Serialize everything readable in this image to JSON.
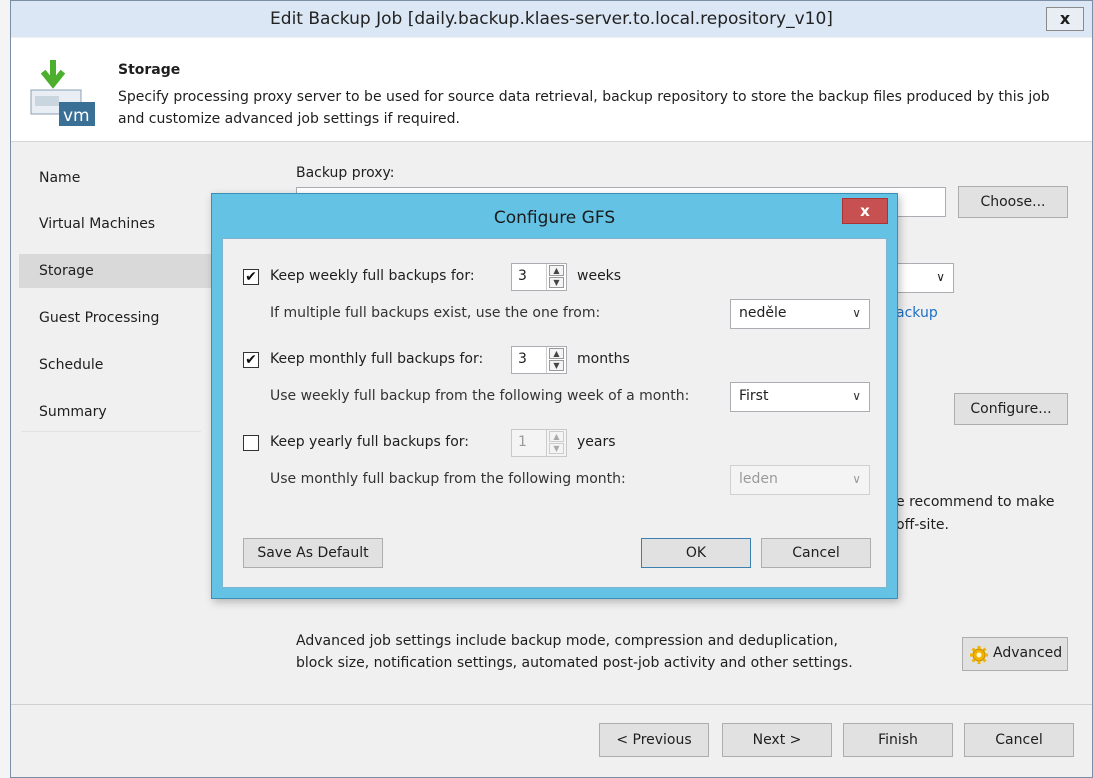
{
  "window": {
    "title": "Edit Backup Job [daily.backup.klaes-server.to.local.repository_v10]",
    "close_glyph": "x"
  },
  "header": {
    "icon_text": "vm",
    "title": "Storage",
    "description": "Specify processing proxy server to be used for source data retrieval, backup repository to store the backup files produced by this job and customize advanced job settings if required."
  },
  "nav": {
    "items": [
      {
        "label": "Name"
      },
      {
        "label": "Virtual Machines"
      },
      {
        "label": "Storage"
      },
      {
        "label": "Guest Processing"
      },
      {
        "label": "Schedule"
      },
      {
        "label": "Summary"
      }
    ],
    "active_index": 2
  },
  "content": {
    "backup_proxy_label": "Backup proxy:",
    "choose_button": "Choose...",
    "backup_link_fragment": "ackup",
    "configure_button": "Configure...",
    "recommend_line1": "e recommend to make",
    "recommend_line2": "off-site.",
    "advanced_text_line1": "Advanced job settings include backup mode, compression and deduplication,",
    "advanced_text_line2": "block size, notification settings, automated post-job activity and other settings.",
    "advanced_button": "Advanced"
  },
  "footer": {
    "previous": "< Previous",
    "next": "Next >",
    "finish": "Finish",
    "cancel": "Cancel"
  },
  "dialog": {
    "title": "Configure GFS",
    "close_glyph": "x",
    "weekly": {
      "checked": true,
      "label": "Keep weekly full backups for:",
      "value": "3",
      "unit": "weeks",
      "sub_label": "If multiple full backups exist, use the one from:",
      "selected": "neděle"
    },
    "monthly": {
      "checked": true,
      "label": "Keep monthly full backups for:",
      "value": "3",
      "unit": "months",
      "sub_label": "Use weekly full backup from the following week of a month:",
      "selected": "First"
    },
    "yearly": {
      "checked": false,
      "label": "Keep yearly full backups for:",
      "value": "1",
      "unit": "years",
      "sub_label": "Use monthly full backup from the following month:",
      "selected": "leden"
    },
    "save_default_button": "Save As Default",
    "ok_button": "OK",
    "cancel_button": "Cancel"
  },
  "glyphs": {
    "check": "✔",
    "caret": "∨",
    "spin_up": "▲",
    "spin_down": "▼"
  },
  "colors": {
    "dialog_frame": "#64c3e5",
    "close_red": "#c75050",
    "vm_arrow_green": "#4caf2e",
    "vm_icon_blue": "#3a6f96",
    "active_nav": "#d9d9d9",
    "link_blue": "#1e6fc4"
  }
}
